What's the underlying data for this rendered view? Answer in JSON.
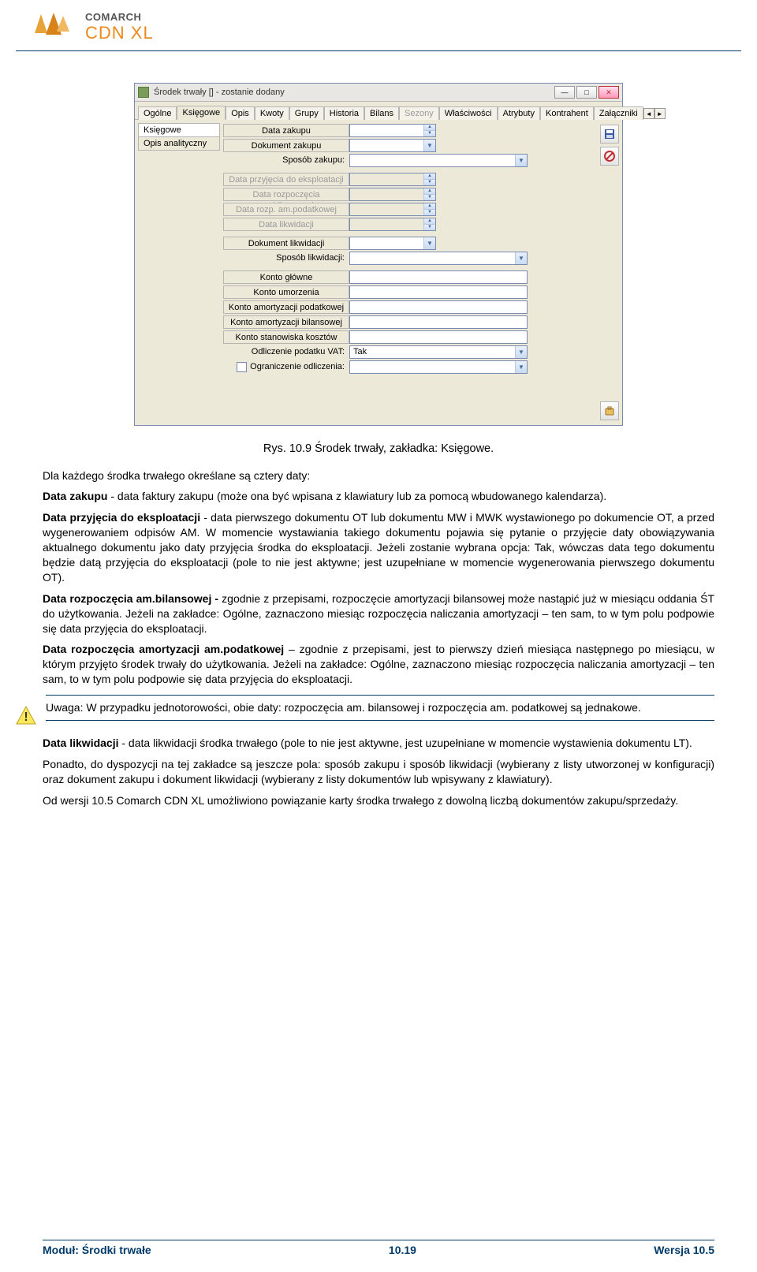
{
  "header": {
    "brand_top": "COMARCH",
    "brand_bottom": "CDN XL"
  },
  "window": {
    "title": "Środek trwały [] - zostanie dodany",
    "tabs": [
      "Ogólne",
      "Księgowe",
      "Opis",
      "Kwoty",
      "Grupy",
      "Historia",
      "Bilans",
      "Sezony",
      "Właściwości",
      "Atrybuty",
      "Kontrahent",
      "Załączniki"
    ],
    "active_tab": 1,
    "disabled_tabs": [
      7
    ],
    "leftnav": [
      "Księgowe",
      "Opis analityczny"
    ],
    "leftnav_active": 0,
    "fields": {
      "data_zakupu": "Data zakupu",
      "dokument_zakupu": "Dokument zakupu",
      "sposob_zakupu": "Sposób zakupu:",
      "data_przyjecia": "Data przyjęcia do eksploatacji",
      "data_rozp_bil": "Data rozpoczęcia am.bilansowej",
      "data_rozp_pod": "Data rozp. am.podatkowej",
      "data_likwidacji": "Data likwidacji",
      "dokument_likwidacji": "Dokument likwidacji",
      "sposob_likwidacji": "Sposób likwidacji:",
      "konto_glowne": "Konto główne",
      "konto_umorzenia": "Konto umorzenia",
      "konto_am_pod": "Konto amortyzacji podatkowej",
      "konto_am_bil": "Konto amortyzacji bilansowej",
      "konto_stan": "Konto stanowiska kosztów",
      "odliczenie_vat": "Odliczenie podatku VAT:",
      "odliczenie_vat_val": "Tak",
      "ograniczenie": "Ograniczenie odliczenia:"
    }
  },
  "caption": "Rys. 10.9 Środek trwały, zakładka: Księgowe.",
  "para_intro": "Dla każdego środka trwałego określane są cztery daty:",
  "para_data_zakupu_b": "Data zakupu",
  "para_data_zakupu": " - data faktury zakupu (może ona być wpisana z klawiatury lub za pomocą wbudowanego kalendarza).",
  "para_data_przyj_b": "Data przyjęcia do eksploatacji",
  "para_data_przyj": " - data pierwszego dokumentu OT lub dokumentu MW i MWK wystawionego po dokumencie OT, a przed wygenerowaniem odpisów AM. W momencie wystawiania takiego dokumentu pojawia się pytanie o przyjęcie daty obowiązywania aktualnego dokumentu jako daty przyjęcia środka do eksploatacji. Jeżeli zostanie wybrana opcja: Tak, wówczas data tego dokumentu będzie datą przyjęcia do eksploatacji (pole to nie jest aktywne; jest uzupełniane w momencie wygenerowania pierwszego dokumentu OT).",
  "para_data_rozp_bil_b": "Data rozpoczęcia am.bilansowej -",
  "para_data_rozp_bil": " zgodnie z przepisami, rozpoczęcie amortyzacji bilansowej może nastąpić już w miesiącu oddania ŚT do użytkowania. Jeżeli na zakładce: Ogólne, zaznaczono miesiąc rozpoczęcia naliczania amortyzacji – ten sam, to w tym polu podpowie się data przyjęcia do eksploatacji.",
  "para_data_rozp_pod_b": "Data rozpoczęcia amortyzacji am.podatkowej",
  "para_data_rozp_pod": " – zgodnie z przepisami, jest to pierwszy dzień miesiąca następnego po miesiącu, w którym przyjęto środek trwały do użytkowania. Jeżeli na zakładce: Ogólne, zaznaczono miesiąc rozpoczęcia naliczania amortyzacji – ten sam, to w tym polu podpowie się data przyjęcia do eksploatacji.",
  "note": "Uwaga: W przypadku jednotorowości, obie daty: rozpoczęcia am. bilansowej i rozpoczęcia am. podatkowej  są jednakowe.",
  "para_data_likw_b": "Data likwidacji",
  "para_data_likw": " - data likwidacji środka trwałego (pole to nie jest aktywne, jest uzupełniane w momencie wystawienia dokumentu LT).",
  "para_ponadto": "Ponadto, do dyspozycji na tej zakładce są jeszcze pola: sposób zakupu i sposób likwidacji (wybierany z listy utworzonej w konfiguracji) oraz dokument zakupu i dokument likwidacji (wybierany z listy dokumentów lub wpisywany z klawiatury).",
  "para_wersja": "Od wersji 10.5 Comarch CDN XL umożliwiono powiązanie karty środka trwałego  z dowolną liczbą dokumentów zakupu/sprzedaży.",
  "footer": {
    "left": "Moduł: Środki trwałe",
    "mid": "10.19",
    "right": "Wersja 10.5"
  }
}
